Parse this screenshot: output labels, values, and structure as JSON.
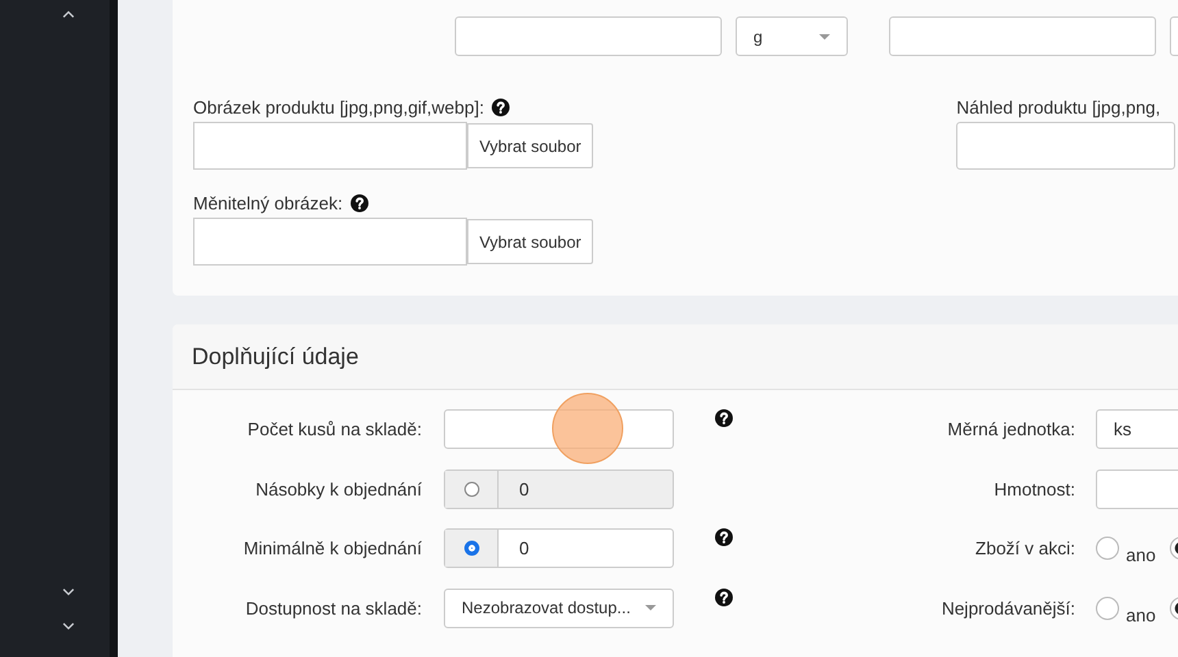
{
  "product_card": {
    "quantity": {
      "unit": "g"
    },
    "image": {
      "label": "Obrázek produktu [jpg,png,gif,webp]:",
      "help": true,
      "button": "Vybrat soubor"
    },
    "preview": {
      "label": "Náhled produktu [jpg,png,"
    },
    "variable_image": {
      "label": "Měnitelný obrázek:",
      "help": true,
      "button": "Vybrat soubor"
    }
  },
  "extra_card": {
    "title": "Doplňující údaje",
    "left_rows": [
      {
        "kind": "text",
        "label": "Počet kusů na skladě:",
        "help": true
      },
      {
        "kind": "radio-number",
        "label": "Násobky k objednání",
        "checked": false,
        "disabled": true,
        "value": "0"
      },
      {
        "kind": "radio-number",
        "label": "Minimálně k objednání",
        "checked": true,
        "disabled": false,
        "value": "0",
        "help": true
      },
      {
        "kind": "select",
        "label": "Dostupnost na skladě:",
        "value": "Nezobrazovat dostup...",
        "help": true
      }
    ],
    "right_rows": [
      {
        "kind": "text",
        "label": "Měrná jednotka:",
        "value": "ks"
      },
      {
        "kind": "text",
        "label": "Hmotnost:"
      },
      {
        "kind": "radios",
        "label": "Zboží v akci:",
        "options": [
          {
            "label": "ano",
            "selected": false
          },
          {
            "selected": true
          }
        ]
      },
      {
        "kind": "radios",
        "label": "Nejprodávanější:",
        "options": [
          {
            "label": "ano",
            "selected": false
          },
          {
            "selected": true
          }
        ]
      }
    ]
  }
}
